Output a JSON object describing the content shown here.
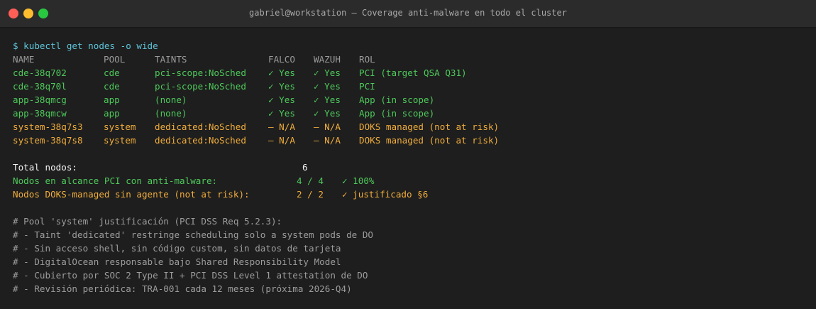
{
  "window": {
    "title": "gabriel@workstation — Coverage anti-malware en todo el cluster",
    "colors": {
      "close": "#ff5f57",
      "minimize": "#febc2e",
      "maximize": "#28c840",
      "background": "#1e1e1e"
    }
  },
  "command": "$ kubectl get nodes -o wide",
  "table": {
    "headers": [
      "NAME",
      "POOL",
      "TAINTS",
      "FALCO",
      "WAZUH",
      "ROL"
    ],
    "rows": [
      {
        "name": "cde-38q702",
        "pool": "cde",
        "taints": "pci-scope:NoSched",
        "falco": "✓ Yes",
        "wazuh": "✓ Yes",
        "rol": "PCI (target QSA Q31)",
        "status": "green"
      },
      {
        "name": "cde-38q70l",
        "pool": "cde",
        "taints": "pci-scope:NoSched",
        "falco": "✓ Yes",
        "wazuh": "✓ Yes",
        "rol": "PCI",
        "status": "green"
      },
      {
        "name": "app-38qmcg",
        "pool": "app",
        "taints": "(none)",
        "falco": "✓ Yes",
        "wazuh": "✓ Yes",
        "rol": "App (in scope)",
        "status": "green"
      },
      {
        "name": "app-38qmcw",
        "pool": "app",
        "taints": "(none)",
        "falco": "✓ Yes",
        "wazuh": "✓ Yes",
        "rol": "App (in scope)",
        "status": "green"
      },
      {
        "name": "system-38q7s3",
        "pool": "system",
        "taints": "dedicated:NoSched",
        "falco": "— N/A",
        "wazuh": "— N/A",
        "rol": "DOKS managed (not at risk)",
        "status": "orange"
      },
      {
        "name": "system-38q7s8",
        "pool": "system",
        "taints": "dedicated:NoSched",
        "falco": "— N/A",
        "wazuh": "— N/A",
        "rol": "DOKS managed (not at risk)",
        "status": "orange"
      }
    ]
  },
  "summary": {
    "total": {
      "label": "Total nodos:",
      "value": "6"
    },
    "pci": {
      "label": "Nodos en alcance PCI con anti-malware:",
      "value": "4 / 4",
      "note": "✓ 100%"
    },
    "doks": {
      "label": "Nodos DOKS-managed sin agente (not at risk):",
      "value": "2 / 2",
      "note": "✓ justificado §6"
    }
  },
  "comments": [
    "# Pool 'system' justificación (PCI DSS Req 5.2.3):",
    "# - Taint 'dedicated' restringe scheduling solo a system pods de DO",
    "# - Sin acceso shell, sin código custom, sin datos de tarjeta",
    "# - DigitalOcean responsable bajo Shared Responsibility Model",
    "# - Cubierto por SOC 2 Type II + PCI DSS Level 1 attestation de DO",
    "# - Revisión periódica: TRA-001 cada 12 meses (próxima 2026-Q4)"
  ]
}
